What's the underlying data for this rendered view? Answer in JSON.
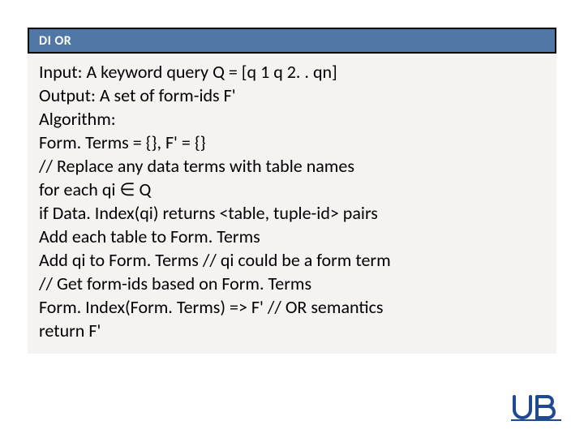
{
  "header": {
    "title": "DI OR"
  },
  "algorithm": {
    "lines": [
      "Input: A keyword query Q = [q 1 q 2. . qn]",
      "Output: A set of form-ids F'",
      "Algorithm:",
      "Form. Terms = {}, F' = {}",
      "// Replace any data terms with table names",
      "for each qi ∈ Q",
      "if Data. Index(qi) returns <table, tuple-id> pairs",
      "Add each table to Form. Terms",
      "Add qi to Form. Terms // qi could be a form term",
      "// Get form-ids based on Form. Terms",
      "Form. Index(Form. Terms) => F' // OR semantics",
      "return F'"
    ]
  },
  "logo": {
    "name": "ub-logo"
  }
}
